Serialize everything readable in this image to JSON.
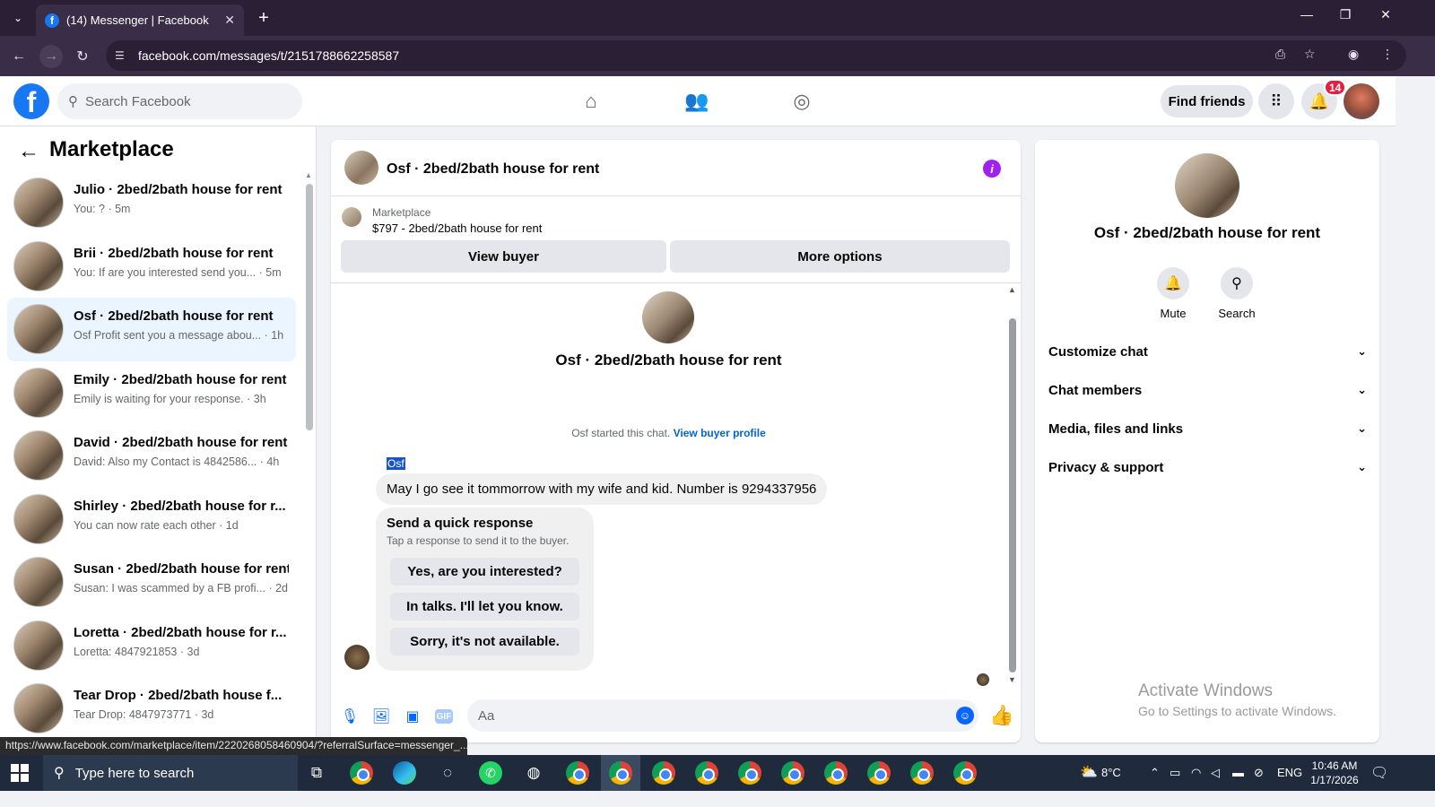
{
  "browser": {
    "tab_title": "(14) Messenger | Facebook",
    "tab_favicon": "f",
    "url": "facebook.com/messages/t/2151788662258587",
    "status_url": "https://www.facebook.com/marketplace/item/2220268058460904/?referralSurface=messenger_..."
  },
  "fb_header": {
    "search_placeholder": "Search Facebook",
    "find_friends_label": "Find friends",
    "notification_count": "14"
  },
  "sidebar": {
    "title": "Marketplace",
    "conversations": [
      {
        "name": "Julio · 2bed/2bath house for rent",
        "preview": "You: ? · 5m"
      },
      {
        "name": "Brii · 2bed/2bath house for rent",
        "preview": "You: If are you interested send you... · 5m"
      },
      {
        "name": "Osf · 2bed/2bath house for rent",
        "preview": "Osf Profit sent you a message abou... · 1h"
      },
      {
        "name": "Emily · 2bed/2bath house for rent",
        "preview": "Emily is waiting for your response. · 3h"
      },
      {
        "name": "David · 2bed/2bath house for rent",
        "preview": "David: Also my Contact is 4842586...  · 4h"
      },
      {
        "name": "Shirley · 2bed/2bath house for r...",
        "preview": "You can now rate each other · 1d"
      },
      {
        "name": "Susan · 2bed/2bath house for rent",
        "preview": "Susan: I was scammed by a FB profi... · 2d"
      },
      {
        "name": "Loretta · 2bed/2bath house for r...",
        "preview": "Loretta: 4847921853 · 3d"
      },
      {
        "name": "Tear Drop · 2bed/2bath house f...",
        "preview": "Tear Drop: 4847973771 · 3d"
      }
    ]
  },
  "chat": {
    "title": "Osf · 2bed/2bath house for rent",
    "marketplace_label": "Marketplace",
    "listing": "$797 - 2bed/2bath house for rent",
    "view_buyer_label": "View buyer",
    "more_options_label": "More options",
    "intro_name": "Osf · 2bed/2bath house for rent",
    "started_text": "Osf started this chat.",
    "view_buyer_profile": "View buyer profile",
    "sender": "Osf",
    "message": "May I go see it tommorrow with my wife and kid. Number is 9294337956",
    "quick_response_title": "Send a quick response",
    "quick_response_sub": "Tap a response to send it to the buyer.",
    "quick_responses": [
      "Yes, are you interested?",
      "In talks. I'll let you know.",
      "Sorry, it's not available."
    ],
    "composer_placeholder": "Aa"
  },
  "right_panel": {
    "name": "Osf · 2bed/2bath house for rent",
    "mute_label": "Mute",
    "search_label": "Search",
    "menu": [
      "Customize chat",
      "Chat members",
      "Media, files and links",
      "Privacy & support"
    ],
    "watermark_title": "Activate Windows",
    "watermark_sub": "Go to Settings to activate Windows."
  },
  "taskbar": {
    "search_placeholder": "Type here to search",
    "weather": "8°C",
    "language": "ENG",
    "time": "10:46 AM",
    "date": "1/17/2026"
  }
}
